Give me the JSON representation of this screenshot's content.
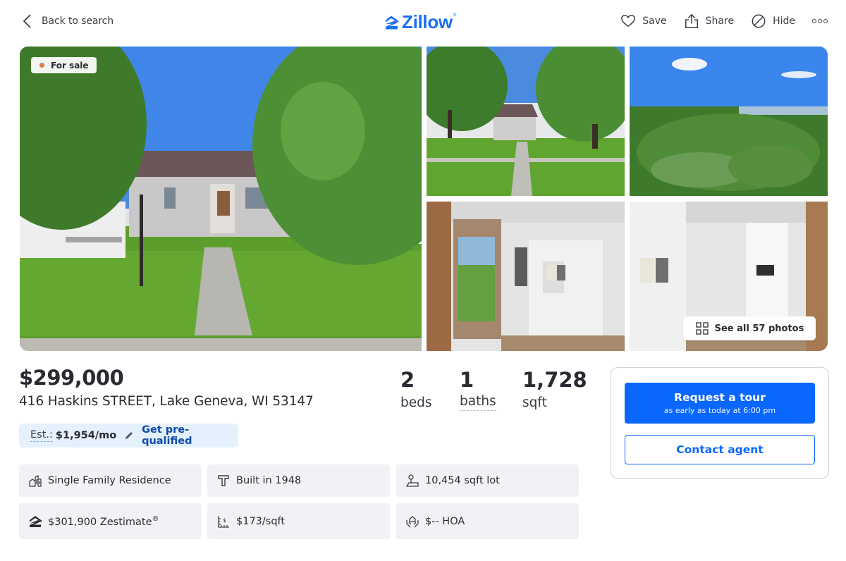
{
  "header": {
    "back_label": "Back to search",
    "logo_text": "Zillow",
    "logo_mark": "®",
    "actions": [
      {
        "icon": "heart-icon",
        "label": "Save"
      },
      {
        "icon": "share-icon",
        "label": "Share"
      },
      {
        "icon": "hide-icon",
        "label": "Hide"
      }
    ],
    "more_icon": "more-options-icon"
  },
  "gallery": {
    "status_badge": "For sale",
    "status_color": "#d9804a",
    "see_all_label": "See all 57 photos",
    "photos": [
      {
        "description": "Front exterior of single-story house with lawn and walkway"
      },
      {
        "description": "Street view of house between large trees"
      },
      {
        "description": "Aerial view of neighborhood and lake"
      },
      {
        "description": "Entryway mudroom with open door and cabinets"
      },
      {
        "description": "Mudroom cabinets with backpacks and office beyond"
      }
    ]
  },
  "listing": {
    "price": "$299,000",
    "address": "416 Haskins STREET, Lake Geneva, WI 53147",
    "stats": [
      {
        "value": "2",
        "label": "beds"
      },
      {
        "value": "1",
        "label": "baths"
      },
      {
        "value": "1,728",
        "label": "sqft"
      }
    ],
    "estimate": {
      "label": "Est.:",
      "value": "$1,954/mo",
      "link": "Get pre-qualified"
    },
    "facts": [
      {
        "icon": "home-type-icon",
        "text": "Single Family Residence"
      },
      {
        "icon": "hammer-icon",
        "text": "Built in 1948"
      },
      {
        "icon": "lot-icon",
        "text": "10,454 sqft lot"
      },
      {
        "icon": "zestimate-icon",
        "text": "$301,900 Zestimate",
        "sup": "®"
      },
      {
        "icon": "price-per-sqft-icon",
        "text": "$173/sqft"
      },
      {
        "icon": "hoa-icon",
        "text": "$-- HOA"
      }
    ]
  },
  "contact": {
    "tour_label": "Request a tour",
    "tour_sub": "as early as today at 6:00 pm",
    "contact_label": "Contact agent"
  },
  "colors": {
    "brand": "#1a6ff4",
    "primary_button": "#0a67ff",
    "estimate_bg": "#e5f0fd",
    "link_dark_blue": "#0d4ba8"
  }
}
